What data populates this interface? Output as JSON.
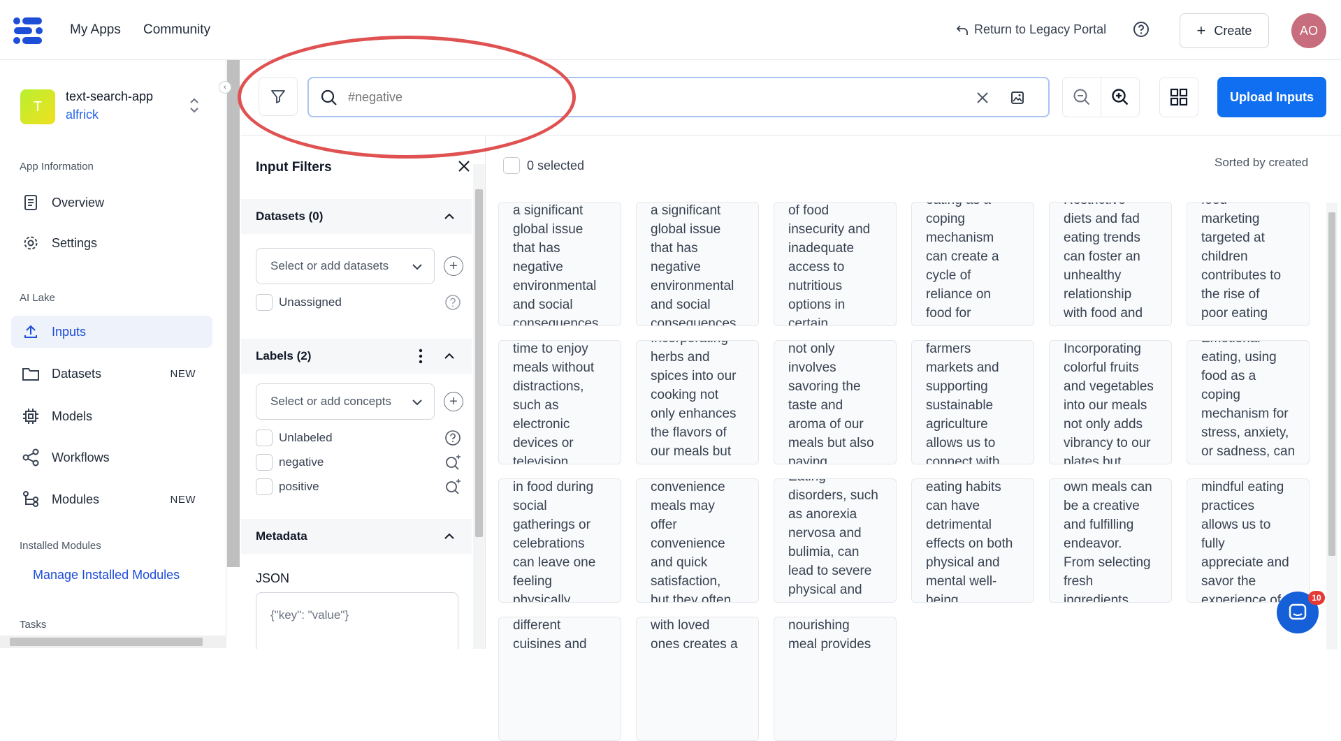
{
  "topbar": {
    "nav": [
      "My Apps",
      "Community"
    ],
    "legacy_link": "Return to Legacy Portal",
    "create_label": "Create",
    "avatar_initials": "AO"
  },
  "sidebar": {
    "app_initial": "T",
    "app_name": "text-search-app",
    "app_owner": "alfrick",
    "section_app_info": "App Information",
    "overview": "Overview",
    "settings": "Settings",
    "section_ai_lake": "AI Lake",
    "inputs": "Inputs",
    "datasets": "Datasets",
    "datasets_badge": "NEW",
    "models": "Models",
    "workflows": "Workflows",
    "modules": "Modules",
    "modules_badge": "NEW",
    "section_installed": "Installed Modules",
    "manage_installed": "Manage Installed Modules",
    "section_tasks": "Tasks"
  },
  "search": {
    "placeholder": "#negative",
    "value": ""
  },
  "toolbar": {
    "upload_label": "Upload Inputs"
  },
  "filters": {
    "title": "Input Filters",
    "datasets_title": "Datasets (0)",
    "datasets_placeholder": "Select or add datasets",
    "unassigned": "Unassigned",
    "labels_title": "Labels (2)",
    "concepts_placeholder": "Select or add concepts",
    "label_options": [
      "Unlabeled",
      "negative",
      "positive"
    ],
    "metadata_title": "Metadata",
    "json_label": "JSON",
    "json_placeholder": "{\"key\": \"value\"}"
  },
  "grid": {
    "selected_text": "0 selected",
    "sort_text": "Sorted by created",
    "cards": [
      [
        "a significant",
        "global issue",
        "that has",
        "negative",
        "environmental",
        "and social",
        "consequences."
      ],
      [
        "a significant",
        "global issue",
        "that has",
        "negative",
        "environmental",
        "and social",
        "consequences."
      ],
      [
        "of food",
        "insecurity and",
        "inadequate",
        "access to",
        "nutritious",
        "options in",
        "certain"
      ],
      [
        "eating as a",
        "coping",
        "mechanism",
        "can create a",
        "cycle of",
        "reliance on",
        "food for"
      ],
      [
        "Restrictive",
        "diets and fad",
        "eating trends",
        "can foster an",
        "unhealthy",
        "relationship",
        "with food and"
      ],
      [
        "food",
        "marketing",
        "targeted at",
        "children",
        "contributes to",
        "the rise of",
        "poor eating"
      ],
      [
        "time to enjoy",
        "meals without",
        "distractions,",
        "such as",
        "electronic",
        "devices or",
        "television"
      ],
      [
        "Incorporating",
        "herbs and",
        "spices into our",
        "cooking not",
        "only enhances",
        "the flavors of",
        "our meals but"
      ],
      [
        "not only",
        "involves",
        "savoring the",
        "taste and",
        "aroma of our",
        "meals but also",
        "paying"
      ],
      [
        "farmers",
        "markets and",
        "supporting",
        "sustainable",
        "agriculture",
        "allows us to",
        "connect with"
      ],
      [
        "Incorporating",
        "colorful fruits",
        "and vegetables",
        "into our meals",
        "not only adds",
        "vibrancy to our",
        "plates but"
      ],
      [
        "Emotional",
        "eating, using",
        "food as a",
        "coping",
        "mechanism for",
        "stress, anxiety,",
        "or sadness, can"
      ],
      [
        "in food during",
        "social",
        "gatherings or",
        "celebrations",
        "can leave one",
        "feeling",
        "physically"
      ],
      [
        "convenience",
        "meals may",
        "offer",
        "convenience",
        "and quick",
        "satisfaction,",
        "but they often"
      ],
      [
        "Eating",
        "disorders, such",
        "as anorexia",
        "nervosa and",
        "bulimia, can",
        "lead to severe",
        "physical and"
      ],
      [
        "eating habits",
        "can have",
        "detrimental",
        "effects on both",
        "physical and",
        "mental well-",
        "being."
      ],
      [
        "own meals can",
        "be a creative",
        "and fulfilling",
        "endeavor.",
        "From selecting",
        "fresh",
        "ingredients"
      ],
      [
        "mindful eating",
        "practices",
        "allows us to",
        "fully",
        "appreciate and",
        "savor the",
        "experience of"
      ],
      [
        "different",
        "cuisines and"
      ],
      [
        "with loved",
        "ones creates a"
      ],
      [
        "nourishing",
        "meal provides"
      ]
    ]
  },
  "chat": {
    "notification_count": "10"
  },
  "colors": {
    "accent": "#0f6ff0",
    "annotation_circle": "#e05252",
    "avatar": "#c86d7d"
  }
}
